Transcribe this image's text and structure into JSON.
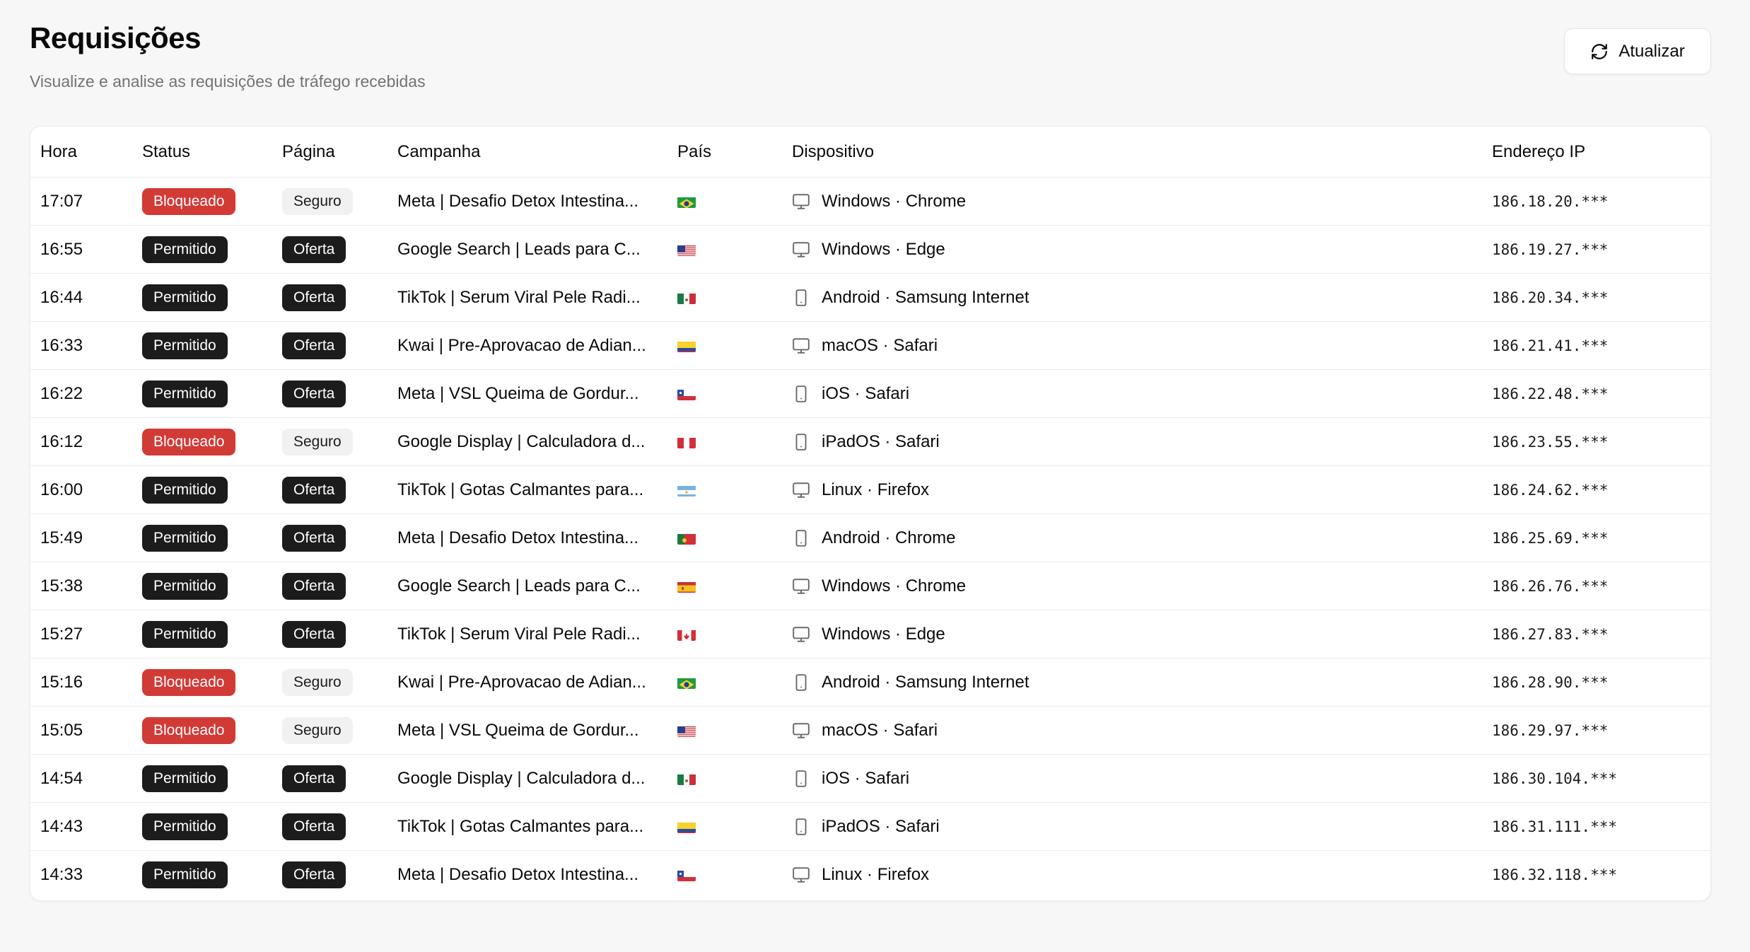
{
  "header": {
    "title": "Requisições",
    "subtitle": "Visualize e analise as requisições de tráfego recebidas",
    "refresh_label": "Atualizar"
  },
  "table": {
    "columns": [
      "Hora",
      "Status",
      "Página",
      "Campanha",
      "País",
      "Dispositivo",
      "Endereço IP"
    ],
    "rows": [
      {
        "hora": "17:07",
        "status": "Bloqueado",
        "pagina": "Seguro",
        "campanha": "Meta | Desafio Detox Intestina...",
        "pais": "BR",
        "device_type": "desktop",
        "dispositivo": "Windows · Chrome",
        "ip": "186.18.20.***"
      },
      {
        "hora": "16:55",
        "status": "Permitido",
        "pagina": "Oferta",
        "campanha": "Google Search | Leads para C...",
        "pais": "US",
        "device_type": "desktop",
        "dispositivo": "Windows · Edge",
        "ip": "186.19.27.***"
      },
      {
        "hora": "16:44",
        "status": "Permitido",
        "pagina": "Oferta",
        "campanha": "TikTok | Serum Viral Pele Radi...",
        "pais": "MX",
        "device_type": "mobile",
        "dispositivo": "Android · Samsung Internet",
        "ip": "186.20.34.***"
      },
      {
        "hora": "16:33",
        "status": "Permitido",
        "pagina": "Oferta",
        "campanha": "Kwai | Pre-Aprovacao de Adian...",
        "pais": "CO",
        "device_type": "desktop",
        "dispositivo": "macOS · Safari",
        "ip": "186.21.41.***"
      },
      {
        "hora": "16:22",
        "status": "Permitido",
        "pagina": "Oferta",
        "campanha": "Meta | VSL Queima de Gordur...",
        "pais": "CL",
        "device_type": "mobile",
        "dispositivo": "iOS · Safari",
        "ip": "186.22.48.***"
      },
      {
        "hora": "16:12",
        "status": "Bloqueado",
        "pagina": "Seguro",
        "campanha": "Google Display | Calculadora d...",
        "pais": "PE",
        "device_type": "mobile",
        "dispositivo": "iPadOS · Safari",
        "ip": "186.23.55.***"
      },
      {
        "hora": "16:00",
        "status": "Permitido",
        "pagina": "Oferta",
        "campanha": "TikTok | Gotas Calmantes para...",
        "pais": "AR",
        "device_type": "desktop",
        "dispositivo": "Linux · Firefox",
        "ip": "186.24.62.***"
      },
      {
        "hora": "15:49",
        "status": "Permitido",
        "pagina": "Oferta",
        "campanha": "Meta | Desafio Detox Intestina...",
        "pais": "PT",
        "device_type": "mobile",
        "dispositivo": "Android · Chrome",
        "ip": "186.25.69.***"
      },
      {
        "hora": "15:38",
        "status": "Permitido",
        "pagina": "Oferta",
        "campanha": "Google Search | Leads para C...",
        "pais": "ES",
        "device_type": "desktop",
        "dispositivo": "Windows · Chrome",
        "ip": "186.26.76.***"
      },
      {
        "hora": "15:27",
        "status": "Permitido",
        "pagina": "Oferta",
        "campanha": "TikTok | Serum Viral Pele Radi...",
        "pais": "CA",
        "device_type": "desktop",
        "dispositivo": "Windows · Edge",
        "ip": "186.27.83.***"
      },
      {
        "hora": "15:16",
        "status": "Bloqueado",
        "pagina": "Seguro",
        "campanha": "Kwai | Pre-Aprovacao de Adian...",
        "pais": "BR",
        "device_type": "mobile",
        "dispositivo": "Android · Samsung Internet",
        "ip": "186.28.90.***"
      },
      {
        "hora": "15:05",
        "status": "Bloqueado",
        "pagina": "Seguro",
        "campanha": "Meta | VSL Queima de Gordur...",
        "pais": "US",
        "device_type": "desktop",
        "dispositivo": "macOS · Safari",
        "ip": "186.29.97.***"
      },
      {
        "hora": "14:54",
        "status": "Permitido",
        "pagina": "Oferta",
        "campanha": "Google Display | Calculadora d...",
        "pais": "MX",
        "device_type": "mobile",
        "dispositivo": "iOS · Safari",
        "ip": "186.30.104.***"
      },
      {
        "hora": "14:43",
        "status": "Permitido",
        "pagina": "Oferta",
        "campanha": "TikTok | Gotas Calmantes para...",
        "pais": "CO",
        "device_type": "mobile",
        "dispositivo": "iPadOS · Safari",
        "ip": "186.31.111.***"
      },
      {
        "hora": "14:33",
        "status": "Permitido",
        "pagina": "Oferta",
        "campanha": "Meta | Desafio Detox Intestina...",
        "pais": "CL",
        "device_type": "desktop",
        "dispositivo": "Linux · Firefox",
        "ip": "186.32.118.***"
      }
    ]
  },
  "colors": {
    "blocked": "#d23a36",
    "allowed": "#1c1c1c",
    "safe_badge": "#f1f1f1"
  },
  "icons": {
    "refresh": "refresh-icon",
    "desktop": "monitor-icon",
    "mobile": "smartphone-icon"
  }
}
